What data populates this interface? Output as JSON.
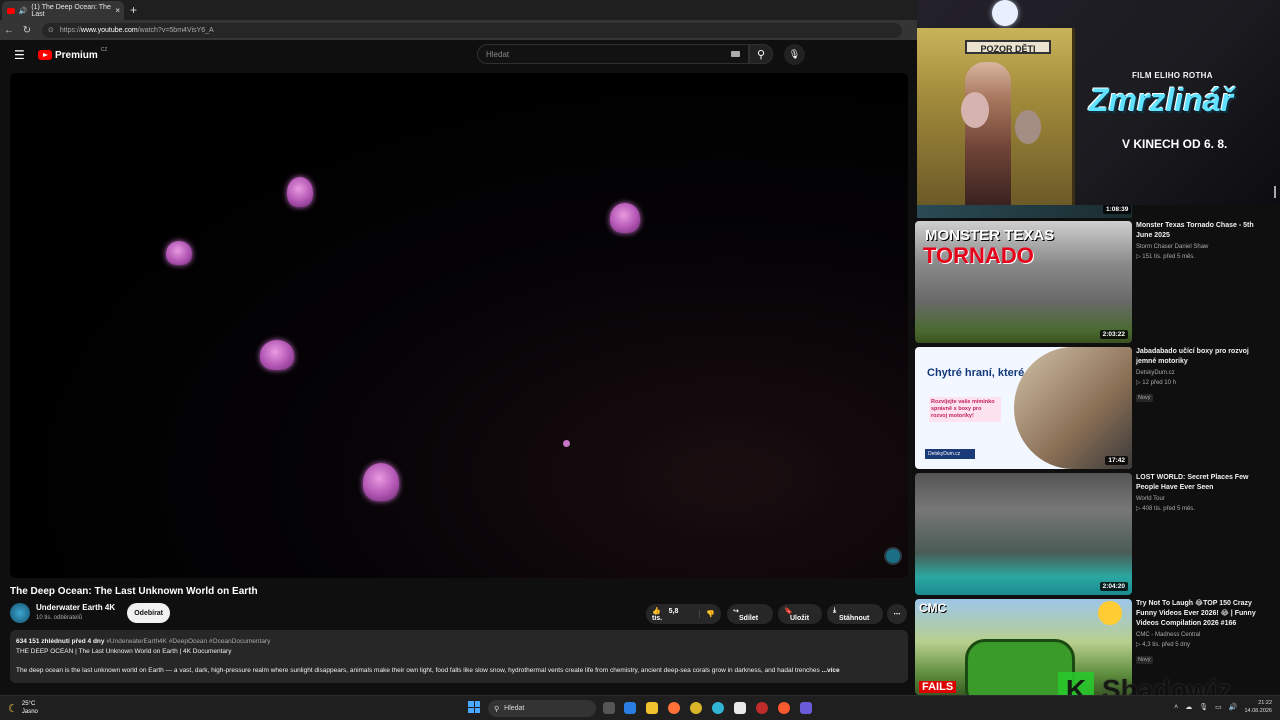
{
  "browser": {
    "tab_title": "(1) The Deep Ocean: The Last",
    "tab_close": "×",
    "new_tab": "+",
    "url_prefix": "https://",
    "url_host": "www.youtube.com",
    "url_path": "/watch?v=5bm4VisY6_A"
  },
  "youtube_header": {
    "logo_text": "Premium",
    "logo_sup": "CZ",
    "search_placeholder": "Hledat"
  },
  "video": {
    "title": "The Deep Ocean: The Last Unknown World on Earth",
    "channel_name": "Underwater Earth 4K",
    "subscribers": "10 tis. odběratelů",
    "subscribe_label": "Odebírat",
    "likes": "5,8 tis.",
    "share_label": "Sdílet",
    "save_label": "Uložit",
    "download_label": "Stáhnout",
    "views_date": "634 151 zhlédnutí  před 4 dny",
    "hashtags": "#UnderwaterEarth4K #DeepOcean #OceanDocumentary",
    "desc_line1": "THE DEEP OCEAN | The Last Unknown World on Earth | 4K Documentary",
    "desc_body": "The deep ocean is the last unknown world on Earth — a vast, dark, high-pressure realm where sunlight disappears, animals make their own light, food falls like slow snow, hydrothermal vents create life from chemistry, ancient deep-sea corals grow in darkness, and hadal trenches",
    "more_label": "...více"
  },
  "ad": {
    "sign": "POZOR DĚTI",
    "film_label": "FILM ELIHO ROTHA",
    "title": "Zmrzlinář",
    "date": "V KINECH OD 6. 8."
  },
  "recommendations": [
    {
      "duration": "1:08:39"
    },
    {
      "title": "Monster Texas Tornado Chase - 5th June 2025",
      "channel": "Storm Chaser Daniel Shaw",
      "views": "▷ 151 tis.   před 5 měs.",
      "duration": "2:03:22",
      "thumb_line1": "MONSTER TEXAS",
      "thumb_line2": "TORNADO"
    },
    {
      "title": "Jabadabado učící boxy pro rozvoj jemné motoriky",
      "channel": "DetskyDum.cz",
      "views": "▷ 12   před 10 h",
      "badge": "Nový",
      "duration": "17:42",
      "thumb_line1": "Chytré hraní, které vidíte!",
      "thumb_line2": "Rozvíjejte vaše miminko správně s boxy pro rozvoj motoriky!",
      "thumb_logo": "DetskyDum.cz"
    },
    {
      "title": "LOST WORLD: Secret Places Few People Have Ever Seen",
      "channel": "World Tour",
      "views": "▷ 408 tis.   před 5 měs.",
      "duration": "2:04:20"
    },
    {
      "title": "Try Not To Laugh 😂TOP 150 Crazy Funny Videos Ever 2026! 😂 | Funny Videos Compilation 2026 #166",
      "channel": "CMC - Madness Central",
      "views": "▷ 4,3 tis.   před 5 dny",
      "badge": "Nový",
      "thumb_line1": "CMC",
      "thumb_line2": "FAILS"
    }
  ],
  "taskbar": {
    "temp": "25°C",
    "weather": "Jasno",
    "search": "Hledat",
    "time": "21:22",
    "date": "14.08.2026"
  },
  "watermark": {
    "letter": "K",
    "text": "Shadowiz"
  }
}
